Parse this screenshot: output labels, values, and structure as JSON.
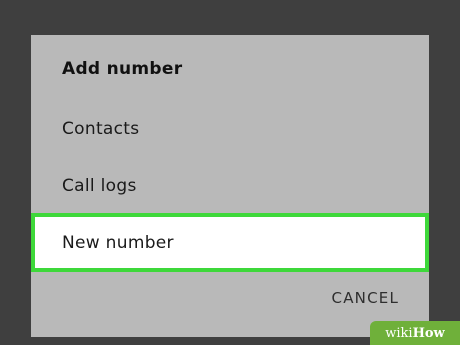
{
  "dialog": {
    "title": "Add number",
    "options": [
      {
        "label": "Contacts"
      },
      {
        "label": "Call logs"
      },
      {
        "label": "New number"
      }
    ],
    "cancel_label": "CANCEL"
  },
  "watermark": {
    "part1": "wiki",
    "part2": "How"
  },
  "colors": {
    "background": "#3f3f3f",
    "dialog": "#b9b9b9",
    "highlight_border": "#3ed83a",
    "selected_option_bg": "#ffffff"
  }
}
